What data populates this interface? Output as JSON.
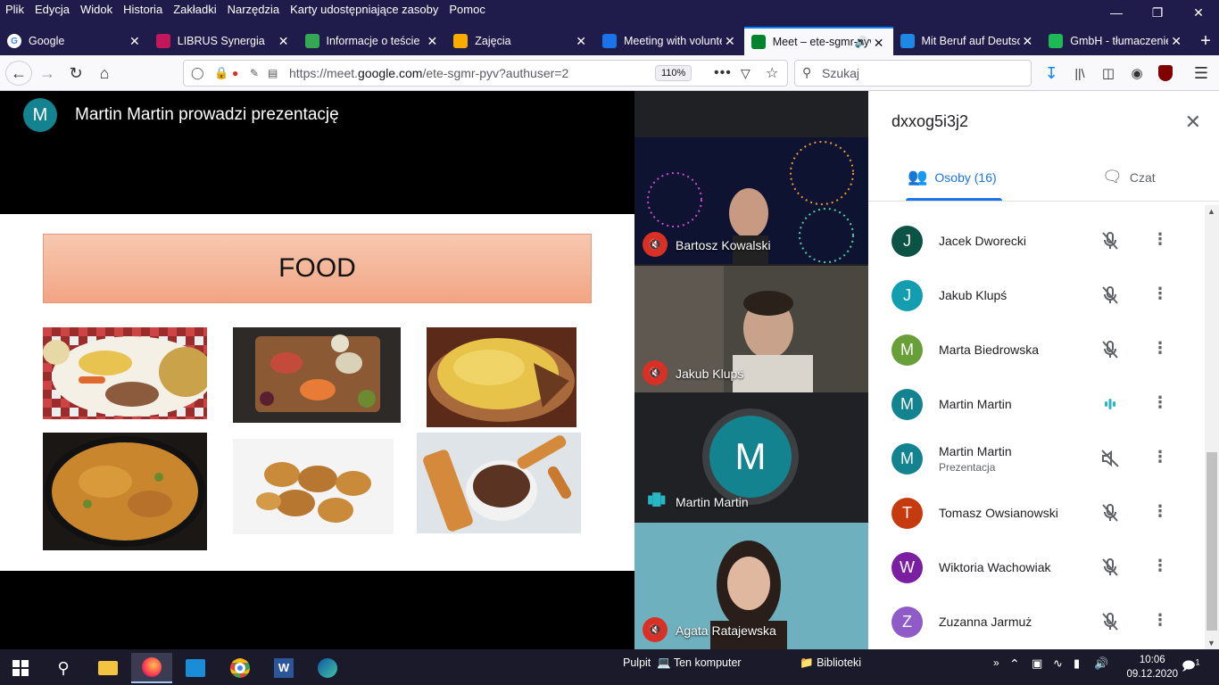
{
  "menubar": {
    "items": [
      "Plik",
      "Edycja",
      "Widok",
      "Historia",
      "Zakładki",
      "Narzędzia",
      "Karty udostępniające zasoby",
      "Pomoc"
    ]
  },
  "tabs": [
    {
      "label": "Google",
      "icon": "google-icon",
      "color": "#ffffff"
    },
    {
      "label": "LIBRUS Synergia",
      "icon": "librus-icon",
      "color": "#c2185b"
    },
    {
      "label": "Informacje o teście",
      "icon": "check-icon",
      "color": "#34a853"
    },
    {
      "label": "Zajęcia",
      "icon": "classroom-icon",
      "color": "#f9ab00"
    },
    {
      "label": "Meeting with volunteers",
      "icon": "contact-icon",
      "color": "#1a73e8"
    },
    {
      "label": "Meet – ete-sgmr-pyv",
      "icon": "meet-icon",
      "color": "#00832d",
      "active": true
    },
    {
      "label": "Mit Beruf auf Deutsch",
      "icon": "globe-icon",
      "color": "#1e88e5"
    },
    {
      "label": "GmbH - tłumaczenie",
      "icon": "green-dot-icon",
      "color": "#1db954"
    }
  ],
  "nav": {
    "url_prefix": "https://meet.",
    "url_domain": "google.com",
    "url_suffix": "/ete-sgmr-pyv?authuser=2",
    "zoom": "110%",
    "search_placeholder": "Szukaj"
  },
  "meet": {
    "presenter_initial": "M",
    "presenter_title": "Martin Martin prowadzi prezentację",
    "slide_title": "FOOD",
    "tiles": [
      {
        "name": "Bartosz Kowalski",
        "muted": true
      },
      {
        "name": "Jakub Klupś",
        "muted": true
      },
      {
        "name": "Martin Martin",
        "muted": false,
        "initial": "M"
      },
      {
        "name": "Agata Ratajewska",
        "muted": true
      }
    ]
  },
  "panel": {
    "meeting_code": "dxxog5i3j2",
    "people_tab": "Osoby (16)",
    "chat_tab": "Czat",
    "people": [
      {
        "initial": "J",
        "name": "Jacek Dworecki",
        "sub": "",
        "color": "#0b5345",
        "status": "muted"
      },
      {
        "initial": "J",
        "name": "Jakub Klupś",
        "sub": "",
        "color": "#129eaf",
        "status": "muted"
      },
      {
        "initial": "M",
        "name": "Marta Biedrowska",
        "sub": "",
        "color": "#689f38",
        "status": "muted"
      },
      {
        "initial": "M",
        "name": "Martin Martin",
        "sub": "",
        "color": "#13838f",
        "status": "speaking"
      },
      {
        "initial": "M",
        "name": "Martin Martin",
        "sub": "Prezentacja",
        "color": "#13838f",
        "status": "audio-off"
      },
      {
        "initial": "T",
        "name": "Tomasz Owsianowski",
        "sub": "",
        "color": "#c53a0e",
        "status": "muted"
      },
      {
        "initial": "W",
        "name": "Wiktoria Wachowiak",
        "sub": "",
        "color": "#7b1fa2",
        "status": "muted"
      },
      {
        "initial": "Z",
        "name": "Zuzanna Jarmuż",
        "sub": "",
        "color": "#8e5bc7",
        "status": "muted"
      }
    ]
  },
  "taskbar": {
    "desktop_label": "Pulpit",
    "computer_label": "Ten komputer",
    "libraries_label": "Biblioteki",
    "time": "10:06",
    "date": "09.12.2020",
    "notification_count": "1"
  }
}
